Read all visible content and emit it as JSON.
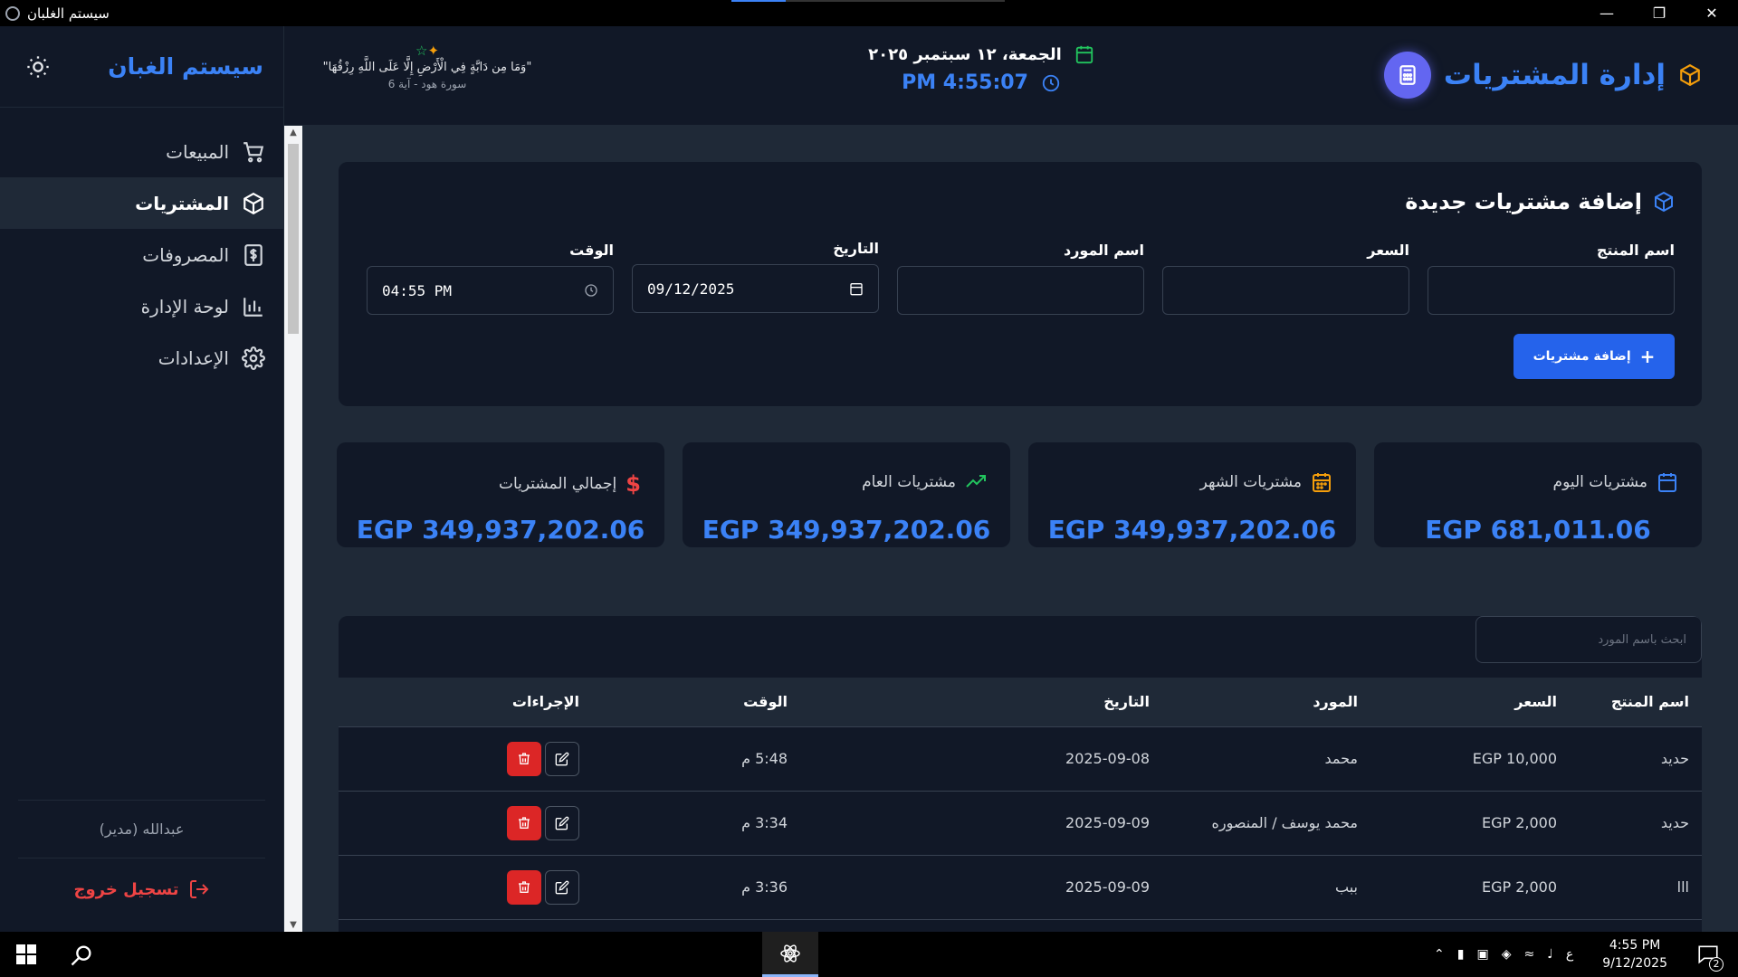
{
  "window": {
    "title": "سيستم الغلبان",
    "progress_fraction": 0.2
  },
  "sidebar": {
    "brand": "سيستم الغبان",
    "items": [
      {
        "label": "المبيعات",
        "icon": "cart-icon",
        "active": false
      },
      {
        "label": "المشتريات",
        "icon": "box-icon",
        "active": true
      },
      {
        "label": "المصروفات",
        "icon": "dollar-receipt-icon",
        "active": false
      },
      {
        "label": "لوحة الإدارة",
        "icon": "bar-chart-icon",
        "active": false
      },
      {
        "label": "الإعدادات",
        "icon": "gear-icon",
        "active": false
      }
    ],
    "user": "عبدالله (مدير)",
    "logout": "تسجيل خروج"
  },
  "header": {
    "verse_text": "\"وَمَا مِن دَابَّةٍ فِي الْأَرْضِ إِلَّا عَلَى اللَّهِ رِزْقُهَا\"",
    "verse_ref": "سورة هود - آية 6",
    "date": "الجمعة، ١٢ سبتمبر ٢٠٢٥",
    "time": "PM 4:55:07",
    "page_title": "إدارة المشتريات"
  },
  "form": {
    "title": "إضافة مشتريات جديدة",
    "fields": {
      "product": {
        "label": "اسم المنتج",
        "value": ""
      },
      "price": {
        "label": "السعر",
        "value": ""
      },
      "supplier": {
        "label": "اسم المورد",
        "value": ""
      },
      "date": {
        "label": "التاريخ",
        "value": "09/12/2025"
      },
      "time": {
        "label": "الوقت",
        "value": "04:55 PM"
      }
    },
    "submit": "إضافة مشتريات"
  },
  "stats": [
    {
      "label": "مشتريات اليوم",
      "value": "EGP 681,011.06",
      "icon": "calendar-icon",
      "color": "#3b82f6"
    },
    {
      "label": "مشتريات الشهر",
      "value": "EGP 349,937,202.06",
      "icon": "calendar-month-icon",
      "color": "#f59e0b"
    },
    {
      "label": "مشتريات العام",
      "value": "EGP 349,937,202.06",
      "icon": "trending-up-icon",
      "color": "#22c55e"
    },
    {
      "label": "إجمالي المشتريات",
      "value": "EGP 349,937,202.06",
      "icon": "dollar-icon",
      "color": "#ef4444"
    }
  ],
  "table": {
    "search_placeholder": "ابحث باسم المورد",
    "columns": [
      "اسم المنتج",
      "السعر",
      "المورد",
      "التاريخ",
      "الوقت",
      "الإجراءات"
    ],
    "rows": [
      {
        "product": "حديد",
        "price": "EGP 10,000",
        "supplier": "محمد",
        "date": "2025-09-08",
        "time": "5:48 م"
      },
      {
        "product": "حديد",
        "price": "EGP 2,000",
        "supplier": "محمد يوسف / المنصوره",
        "date": "2025-09-09",
        "time": "3:34 م"
      },
      {
        "product": "lll",
        "price": "EGP 2,000",
        "supplier": "ببب",
        "date": "2025-09-09",
        "time": "3:36 م"
      }
    ]
  },
  "taskbar": {
    "lang": "ع",
    "clock_time": "4:55 PM",
    "clock_date": "9/12/2025",
    "notification_count": "2"
  }
}
